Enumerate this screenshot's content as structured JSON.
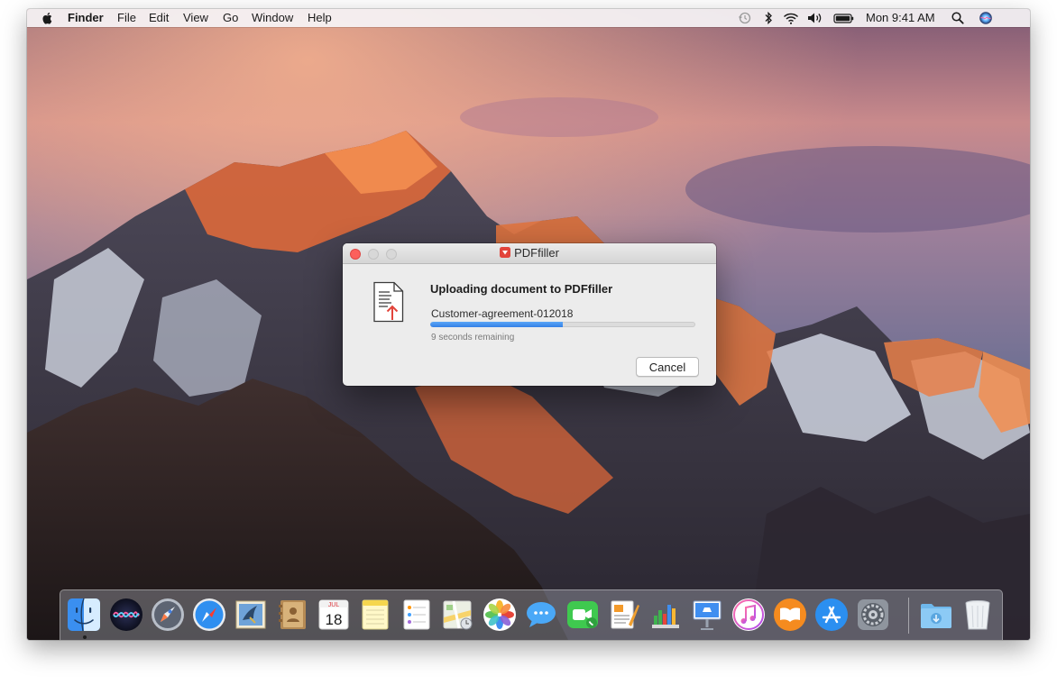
{
  "menubar": {
    "app_name": "Finder",
    "items": [
      "File",
      "Edit",
      "View",
      "Go",
      "Window",
      "Help"
    ],
    "clock": "Mon 9:41 AM",
    "status_icons": [
      "time-machine-icon",
      "bluetooth-icon",
      "wifi-icon",
      "volume-icon",
      "battery-icon",
      "spotlight-icon",
      "siri-icon"
    ]
  },
  "dialog": {
    "window_title": "PDFfiller",
    "heading": "Uploading document to PDFfiller",
    "filename": "Customer-agreement-012018",
    "progress": 0.5,
    "remaining": "9 seconds remaining",
    "cancel_label": "Cancel"
  },
  "dock": {
    "apps": [
      "finder",
      "siri",
      "launchpad",
      "safari",
      "mail",
      "contacts",
      "calendar",
      "notes",
      "reminders",
      "maps",
      "photos",
      "messages",
      "facetime",
      "pages",
      "numbers",
      "keynote",
      "itunes",
      "ibooks",
      "app-store",
      "system-preferences"
    ],
    "calendar": {
      "month": "JUL",
      "day": "18"
    },
    "folders": [
      "downloads",
      "trash"
    ]
  },
  "colors": {
    "accent": "#3580e6",
    "close_button": "#fc605c",
    "brand": "#e2443b"
  }
}
